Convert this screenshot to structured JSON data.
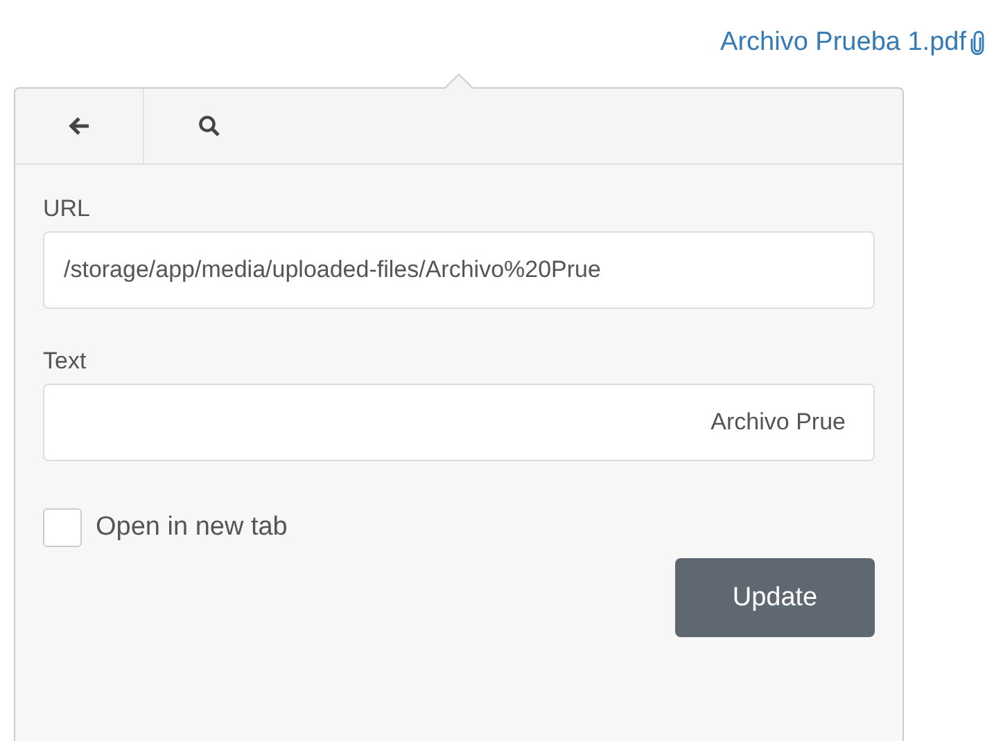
{
  "link": {
    "label": "Archivo Prueba 1.pdf"
  },
  "toolbar": {
    "buttons": [
      {
        "kind": "back"
      },
      {
        "kind": "search"
      }
    ]
  },
  "form": {
    "url": {
      "label": "URL",
      "value": "/storage/app/media/uploaded-files/Archivo%20Prue"
    },
    "text": {
      "label": "Text",
      "value": "Archivo Prue"
    },
    "new_tab": {
      "label": "Open in new tab",
      "checked": false
    },
    "submit": "Update"
  }
}
